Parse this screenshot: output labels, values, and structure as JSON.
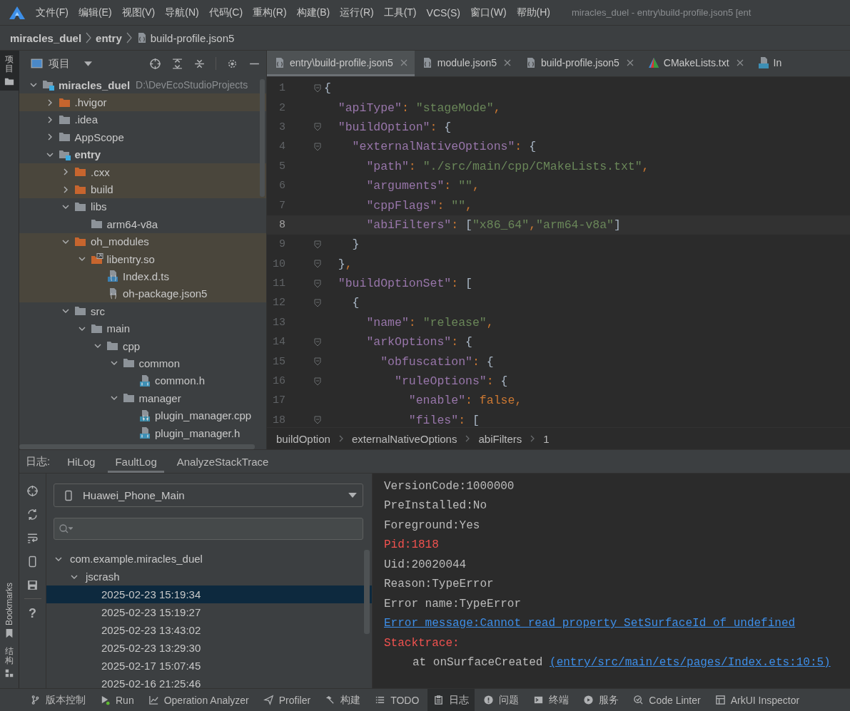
{
  "menu": {
    "items": [
      "文件(F)",
      "编辑(E)",
      "视图(V)",
      "导航(N)",
      "代码(C)",
      "重构(R)",
      "构建(B)",
      "运行(R)",
      "工具(T)",
      "VCS(S)",
      "窗口(W)",
      "帮助(H)"
    ],
    "title": "miracles_duel - entry\\build-profile.json5 [ent"
  },
  "breadcrumb": [
    {
      "label": "miracles_duel",
      "kind": "module"
    },
    {
      "label": "entry",
      "kind": "module"
    },
    {
      "label": "build-profile.json5",
      "kind": "json-file"
    }
  ],
  "side_stripe": {
    "top": [
      {
        "label": "项目",
        "selected": true
      }
    ],
    "bottom": [
      {
        "label": "Bookmarks"
      },
      {
        "label": "结构"
      }
    ]
  },
  "project": {
    "title": "项目",
    "tree": [
      {
        "label": "miracles_duel",
        "path": "D:\\DevEcoStudioProjects",
        "kind": "module",
        "excluded": false,
        "expanded": true,
        "children": [
          {
            "label": ".hvigor",
            "kind": "folder",
            "excluded": true,
            "expanded": false
          },
          {
            "label": ".idea",
            "kind": "folder",
            "excluded": false,
            "expanded": false
          },
          {
            "label": "AppScope",
            "kind": "folder",
            "excluded": false,
            "expanded": false
          },
          {
            "label": "entry",
            "kind": "module",
            "excluded": false,
            "expanded": true,
            "children": [
              {
                "label": ".cxx",
                "kind": "folder",
                "excluded": true,
                "expanded": false
              },
              {
                "label": "build",
                "kind": "folder",
                "excluded": true,
                "expanded": false
              },
              {
                "label": "libs",
                "kind": "folder",
                "excluded": false,
                "expanded": true,
                "children": [
                  {
                    "label": "arm64-v8a",
                    "kind": "folder",
                    "excluded": false
                  }
                ]
              },
              {
                "label": "oh_modules",
                "kind": "folder",
                "excluded": true,
                "expanded": true,
                "children": [
                  {
                    "label": "libentry.so",
                    "kind": "link-folder",
                    "excluded": true,
                    "expanded": true,
                    "children": [
                      {
                        "label": "Index.d.ts",
                        "kind": "ts-file",
                        "excluded": true
                      },
                      {
                        "label": "oh-package.json5",
                        "kind": "json-file",
                        "excluded": true
                      }
                    ]
                  }
                ]
              },
              {
                "label": "src",
                "kind": "folder",
                "excluded": false,
                "expanded": true,
                "children": [
                  {
                    "label": "main",
                    "kind": "folder",
                    "excluded": false,
                    "expanded": true,
                    "children": [
                      {
                        "label": "cpp",
                        "kind": "folder",
                        "excluded": false,
                        "expanded": true,
                        "children": [
                          {
                            "label": "common",
                            "kind": "folder",
                            "excluded": false,
                            "expanded": true,
                            "children": [
                              {
                                "label": "common.h",
                                "kind": "h-file",
                                "excluded": false
                              }
                            ]
                          },
                          {
                            "label": "manager",
                            "kind": "folder",
                            "excluded": false,
                            "expanded": true,
                            "children": [
                              {
                                "label": "plugin_manager.cpp",
                                "kind": "cpp-file",
                                "excluded": false
                              },
                              {
                                "label": "plugin_manager.h",
                                "kind": "h-file",
                                "excluded": false
                              }
                            ]
                          }
                        ]
                      }
                    ]
                  }
                ]
              }
            ]
          }
        ]
      }
    ]
  },
  "editor": {
    "tabs": [
      {
        "label": "entry\\build-profile.json5",
        "kind": "json-file",
        "selected": true,
        "closable": true
      },
      {
        "label": "module.json5",
        "kind": "json-file",
        "selected": false,
        "closable": true
      },
      {
        "label": "build-profile.json5",
        "kind": "json-file",
        "selected": false,
        "closable": true
      },
      {
        "label": "CMakeLists.txt",
        "kind": "cmake-file",
        "selected": false,
        "closable": true
      },
      {
        "label": "In",
        "kind": "ts-file",
        "selected": false,
        "closable": false
      }
    ],
    "lines": [
      {
        "number": "1",
        "fold": true,
        "current": false,
        "tokens": [
          {
            "text": "{",
            "kind": "brace"
          }
        ]
      },
      {
        "number": "2",
        "fold": false,
        "current": false,
        "tokens": [
          {
            "text": "  \"apiType\"",
            "kind": "key"
          },
          {
            "text": ": ",
            "kind": "op"
          },
          {
            "text": "\"stageMode\"",
            "kind": "str"
          },
          {
            "text": ",",
            "kind": "op"
          }
        ]
      },
      {
        "number": "3",
        "fold": true,
        "current": false,
        "tokens": [
          {
            "text": "  \"buildOption\"",
            "kind": "key"
          },
          {
            "text": ": ",
            "kind": "op"
          },
          {
            "text": "{",
            "kind": "brace"
          }
        ]
      },
      {
        "number": "4",
        "fold": true,
        "current": false,
        "tokens": [
          {
            "text": "    \"externalNativeOptions\"",
            "kind": "key"
          },
          {
            "text": ": ",
            "kind": "op"
          },
          {
            "text": "{",
            "kind": "brace"
          }
        ]
      },
      {
        "number": "5",
        "fold": false,
        "current": false,
        "tokens": [
          {
            "text": "      \"path\"",
            "kind": "key"
          },
          {
            "text": ": ",
            "kind": "op"
          },
          {
            "text": "\"./src/main/cpp/CMakeLists.txt\"",
            "kind": "str"
          },
          {
            "text": ",",
            "kind": "op"
          }
        ]
      },
      {
        "number": "6",
        "fold": false,
        "current": false,
        "tokens": [
          {
            "text": "      \"arguments\"",
            "kind": "key"
          },
          {
            "text": ": ",
            "kind": "op"
          },
          {
            "text": "\"\"",
            "kind": "str"
          },
          {
            "text": ",",
            "kind": "op"
          }
        ]
      },
      {
        "number": "7",
        "fold": false,
        "current": false,
        "tokens": [
          {
            "text": "      \"cppFlags\"",
            "kind": "key"
          },
          {
            "text": ": ",
            "kind": "op"
          },
          {
            "text": "\"\"",
            "kind": "str"
          },
          {
            "text": ",",
            "kind": "op"
          }
        ]
      },
      {
        "number": "8",
        "fold": false,
        "current": true,
        "tokens": [
          {
            "text": "      \"abiFilters\"",
            "kind": "key"
          },
          {
            "text": ": ",
            "kind": "op"
          },
          {
            "text": "[",
            "kind": "brace"
          },
          {
            "text": "\"x86_64\"",
            "kind": "str"
          },
          {
            "text": ",",
            "kind": "op"
          },
          {
            "text": "\"arm64-v8a\"",
            "kind": "str"
          },
          {
            "text": "]",
            "kind": "brace"
          }
        ]
      },
      {
        "number": "9",
        "fold": true,
        "current": false,
        "tokens": [
          {
            "text": "    }",
            "kind": "brace"
          }
        ]
      },
      {
        "number": "10",
        "fold": true,
        "current": false,
        "tokens": [
          {
            "text": "  }",
            "kind": "brace"
          },
          {
            "text": ",",
            "kind": "op"
          }
        ]
      },
      {
        "number": "11",
        "fold": true,
        "current": false,
        "tokens": [
          {
            "text": "  \"buildOptionSet\"",
            "kind": "key"
          },
          {
            "text": ": ",
            "kind": "op"
          },
          {
            "text": "[",
            "kind": "brace"
          }
        ]
      },
      {
        "number": "12",
        "fold": true,
        "current": false,
        "tokens": [
          {
            "text": "    {",
            "kind": "brace"
          }
        ]
      },
      {
        "number": "13",
        "fold": false,
        "current": false,
        "tokens": [
          {
            "text": "      \"name\"",
            "kind": "key"
          },
          {
            "text": ": ",
            "kind": "op"
          },
          {
            "text": "\"release\"",
            "kind": "str"
          },
          {
            "text": ",",
            "kind": "op"
          }
        ]
      },
      {
        "number": "14",
        "fold": true,
        "current": false,
        "tokens": [
          {
            "text": "      \"arkOptions\"",
            "kind": "key"
          },
          {
            "text": ": ",
            "kind": "op"
          },
          {
            "text": "{",
            "kind": "brace"
          }
        ]
      },
      {
        "number": "15",
        "fold": true,
        "current": false,
        "tokens": [
          {
            "text": "        \"obfuscation\"",
            "kind": "key"
          },
          {
            "text": ": ",
            "kind": "op"
          },
          {
            "text": "{",
            "kind": "brace"
          }
        ]
      },
      {
        "number": "16",
        "fold": true,
        "current": false,
        "tokens": [
          {
            "text": "          \"ruleOptions\"",
            "kind": "key"
          },
          {
            "text": ": ",
            "kind": "op"
          },
          {
            "text": "{",
            "kind": "brace"
          }
        ]
      },
      {
        "number": "17",
        "fold": false,
        "current": false,
        "tokens": [
          {
            "text": "            \"enable\"",
            "kind": "key"
          },
          {
            "text": ": ",
            "kind": "op"
          },
          {
            "text": "false",
            "kind": "kw"
          },
          {
            "text": ",",
            "kind": "op"
          }
        ]
      },
      {
        "number": "18",
        "fold": true,
        "current": false,
        "tokens": [
          {
            "text": "            \"files\"",
            "kind": "key"
          },
          {
            "text": ": ",
            "kind": "op"
          },
          {
            "text": "[",
            "kind": "brace"
          }
        ]
      }
    ],
    "path": [
      "buildOption",
      "externalNativeOptions",
      "abiFilters",
      "1"
    ]
  },
  "log_panel": {
    "label": "日志:",
    "tabs": [
      {
        "label": "HiLog",
        "selected": false
      },
      {
        "label": "FaultLog",
        "selected": true
      },
      {
        "label": "AnalyzeStackTrace",
        "selected": false
      }
    ],
    "help": "?",
    "device": "Huawei_Phone_Main",
    "fault_tree": [
      {
        "label": "com.example.miracles_duel",
        "expanded": true,
        "children": [
          {
            "label": "jscrash",
            "expanded": true,
            "children": [
              {
                "label": "2025-02-23 15:19:34",
                "selected": true
              },
              {
                "label": "2025-02-23 15:19:27",
                "selected": false
              },
              {
                "label": "2025-02-23 13:43:02",
                "selected": false
              },
              {
                "label": "2025-02-23 13:29:30",
                "selected": false
              },
              {
                "label": "2025-02-17 15:07:45",
                "selected": false
              },
              {
                "label": "2025-02-16 21:25:46",
                "selected": false
              }
            ]
          }
        ]
      }
    ],
    "log_lines": [
      {
        "kind": "info",
        "text": "VersionCode:1000000"
      },
      {
        "kind": "info",
        "text": "PreInstalled:No"
      },
      {
        "kind": "info",
        "text": "Foreground:Yes"
      },
      {
        "kind": "error",
        "text": "Pid:1818"
      },
      {
        "kind": "info",
        "text": "Uid:20020044"
      },
      {
        "kind": "info",
        "text": "Reason:TypeError"
      },
      {
        "kind": "info",
        "text": "Error name:TypeError"
      },
      {
        "kind": "link",
        "text": "Error message:Cannot read property SetSurfaceId of undefined"
      },
      {
        "kind": "error",
        "text": "Stacktrace:"
      },
      {
        "kind": "stack",
        "text": "at onSurfaceCreated",
        "link": "(entry/src/main/ets/pages/Index.ets:10:5)"
      }
    ]
  },
  "status_bar": [
    {
      "label": "版本控制",
      "selected": false
    },
    {
      "label": "Run",
      "selected": false
    },
    {
      "label": "Operation Analyzer",
      "selected": false
    },
    {
      "label": "Profiler",
      "selected": false
    },
    {
      "label": "构建",
      "selected": false
    },
    {
      "label": "TODO",
      "selected": false
    },
    {
      "label": "日志",
      "selected": true
    },
    {
      "label": "问题",
      "selected": false
    },
    {
      "label": "终端",
      "selected": false
    },
    {
      "label": "服务",
      "selected": false
    },
    {
      "label": "Code Linter",
      "selected": false
    },
    {
      "label": "ArkUI Inspector",
      "selected": false
    }
  ]
}
